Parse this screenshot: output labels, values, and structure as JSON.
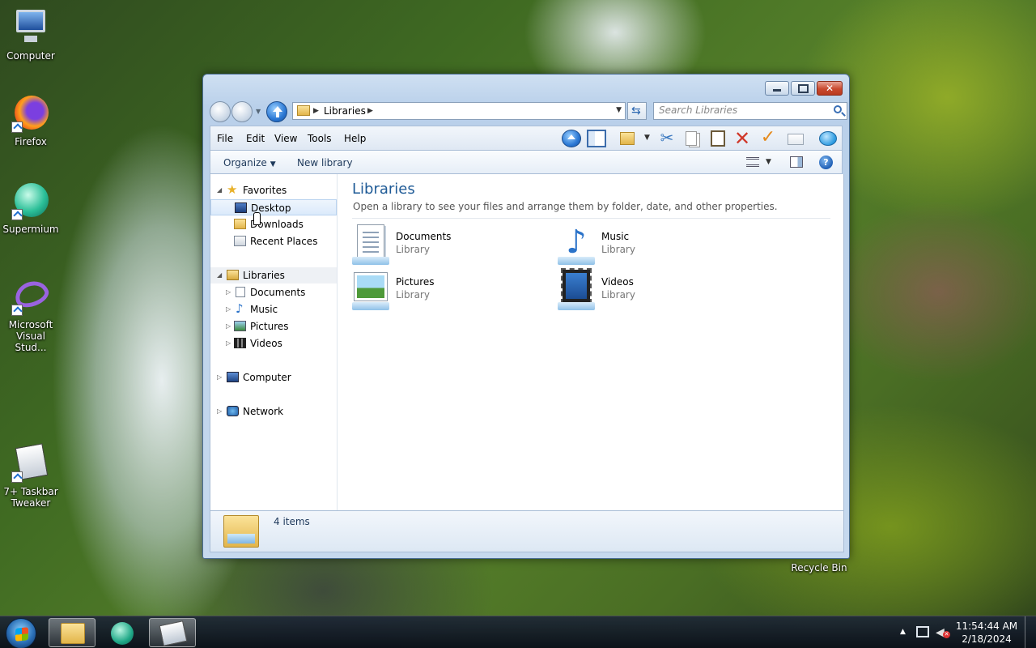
{
  "desktop": {
    "icons": [
      {
        "label": "Computer"
      },
      {
        "label": "Firefox"
      },
      {
        "label": "Supermium"
      },
      {
        "label": "Microsoft Visual Stud..."
      },
      {
        "label": "7+ Taskbar Tweaker"
      },
      {
        "label": "Recycle Bin"
      }
    ]
  },
  "window": {
    "address": {
      "crumb": "Libraries"
    },
    "search": {
      "placeholder": "Search Libraries"
    },
    "menu": {
      "file": "File",
      "edit": "Edit",
      "view": "View",
      "tools": "Tools",
      "help": "Help"
    },
    "command_bar": {
      "organize": "Organize",
      "new_library": "New library"
    },
    "nav": {
      "favorites": "Favorites",
      "desktop": "Desktop",
      "downloads": "Downloads",
      "recent_places": "Recent Places",
      "libraries": "Libraries",
      "documents": "Documents",
      "music": "Music",
      "pictures": "Pictures",
      "videos": "Videos",
      "computer": "Computer",
      "network": "Network"
    },
    "content": {
      "title": "Libraries",
      "description": "Open a library to see your files and arrange them by folder, date, and other properties.",
      "libraries": [
        {
          "name": "Documents",
          "type": "Library"
        },
        {
          "name": "Music",
          "type": "Library"
        },
        {
          "name": "Pictures",
          "type": "Library"
        },
        {
          "name": "Videos",
          "type": "Library"
        }
      ]
    },
    "status": {
      "text": "4 items"
    }
  },
  "taskbar": {
    "clock": {
      "time": "11:54:44 AM",
      "date": "2/18/2024"
    },
    "apps": [
      "Windows Explorer",
      "Supermium",
      "7+ Taskbar Tweaker"
    ]
  }
}
